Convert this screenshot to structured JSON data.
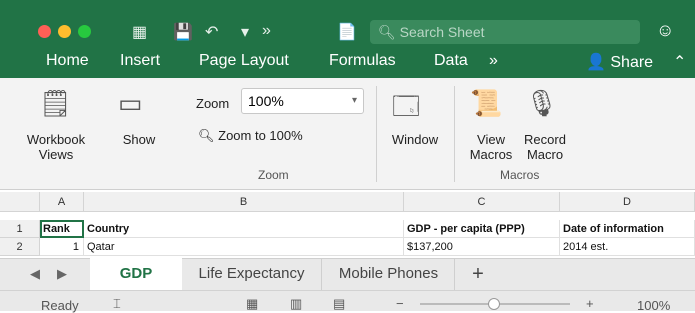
{
  "toolbar": {
    "search_placeholder": "Search Sheet"
  },
  "tabs": [
    "Home",
    "Insert",
    "Page Layout",
    "Formulas",
    "Data",
    "»",
    "Share"
  ],
  "ribbon": {
    "workbook_views": "Workbook\nViews",
    "show": "Show",
    "zoom_label": "Zoom",
    "zoom_value": "100%",
    "zoom_to_100": "Zoom to 100%",
    "zoom_group": "Zoom",
    "window": "Window",
    "view_macros": "View\nMacros",
    "record_macro": "Record\nMacro",
    "macros_group": "Macros"
  },
  "sheet": {
    "columns": [
      "A",
      "B",
      "C",
      "D"
    ],
    "rows": [
      {
        "num": "1",
        "A": "Rank",
        "B": "Country",
        "C": "GDP - per capita (PPP)",
        "D": "Date of information"
      },
      {
        "num": "2",
        "A": "1",
        "B": "Qatar",
        "C": "$137,200",
        "D": "2014 est."
      }
    ]
  },
  "sheet_tabs": [
    "GDP",
    "Life Expectancy",
    "Mobile Phones"
  ],
  "status": {
    "ready": "Ready",
    "zoom": "100%",
    "minus": "−",
    "plus": "+"
  },
  "colors": {
    "brand": "#217346"
  }
}
